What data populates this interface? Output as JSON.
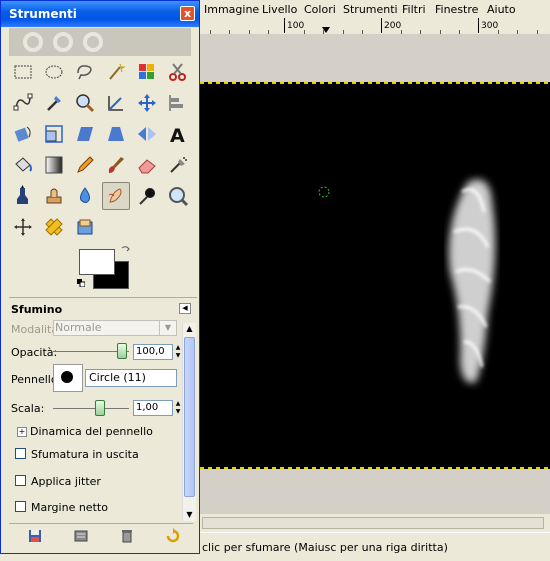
{
  "menubar": {
    "items": [
      "Immagine",
      "Livello",
      "Colori",
      "Strumenti",
      "Filtri",
      "Finestre",
      "Aiuto"
    ]
  },
  "ruler": {
    "ticks": [
      "100",
      "200",
      "300"
    ]
  },
  "status": {
    "text": "clic per sfumare (Maiusc per una riga diritta)"
  },
  "toolbox": {
    "title": "Strumenti",
    "close_label": "x",
    "tools": [
      "rect-select-icon",
      "ellipse-select-icon",
      "lasso-icon",
      "magic-wand-icon",
      "select-by-color-icon",
      "scissors-icon",
      "paths-icon",
      "color-picker-icon",
      "zoom-icon",
      "measure-icon",
      "move-icon",
      "align-icon",
      "rotate-icon",
      "scale-icon",
      "shear-icon",
      "perspective-icon",
      "flip-icon",
      "text-icon",
      "bucket-fill-icon",
      "blend-icon",
      "pencil-icon",
      "paintbrush-icon",
      "eraser-icon",
      "airbrush-icon",
      "ink-icon",
      "clone-icon",
      "blur-sharpen-icon",
      "smudge-icon",
      "dodge-burn-icon",
      "magnify-icon",
      "crop-move-icon",
      "heal-icon",
      "fuzzy-paint-icon"
    ],
    "active_tool": "smudge-icon",
    "colors": {
      "foreground": "#ffffff",
      "background": "#000000"
    }
  },
  "options": {
    "title": "Sfumino",
    "mode_label": "Modalità:",
    "mode_value": "Normale",
    "opacity_label": "Opacità:",
    "opacity_value": "100,0",
    "brush_label": "Pennello:",
    "brush_value": "Circle (11)",
    "scale_label": "Scala:",
    "scale_value": "1,00",
    "dynamics_label": "Dinamica del pennello",
    "fade_label": "Sfumatura in uscita",
    "jitter_label": "Applica jitter",
    "hard_edge_label": "Margine netto"
  },
  "bottom_bar": {
    "icons": [
      "save-options-icon",
      "restore-options-icon",
      "delete-options-icon",
      "reset-options-icon"
    ]
  }
}
